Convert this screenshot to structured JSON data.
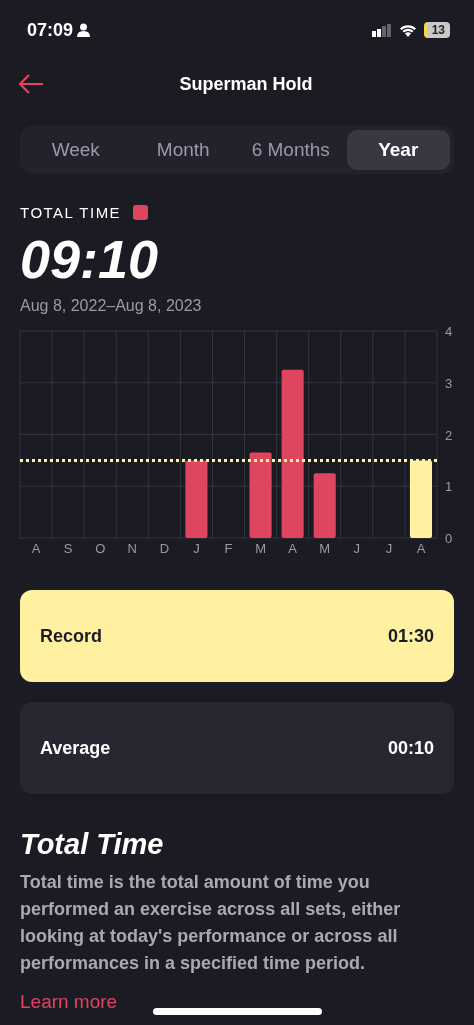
{
  "status_bar": {
    "time": "07:09",
    "battery": "13"
  },
  "header": {
    "title": "Superman Hold"
  },
  "tabs": [
    {
      "label": "Week",
      "selected": false
    },
    {
      "label": "Month",
      "selected": false
    },
    {
      "label": "6 Months",
      "selected": false
    },
    {
      "label": "Year",
      "selected": true
    }
  ],
  "summary": {
    "label": "TOTAL TIME",
    "color": "#e0455f",
    "value": "09:10",
    "range": "Aug 8, 2022–Aug 8, 2023"
  },
  "chart_data": {
    "type": "bar",
    "categories": [
      "A",
      "S",
      "O",
      "N",
      "D",
      "J",
      "F",
      "M",
      "A",
      "M",
      "J",
      "J",
      "A"
    ],
    "ylim": [
      0,
      4
    ],
    "yticks": [
      0,
      1,
      2,
      3,
      4
    ],
    "stacked": true,
    "grid": true,
    "series": [
      {
        "color": "#e0455f",
        "values": [
          null,
          null,
          null,
          null,
          null,
          1.5,
          null,
          1.65,
          3.25,
          1.25,
          null,
          null,
          null
        ]
      },
      {
        "color": "#fff1a0",
        "values": [
          null,
          null,
          null,
          null,
          null,
          null,
          null,
          null,
          null,
          null,
          null,
          null,
          1.5
        ]
      }
    ],
    "ref_lines": [
      {
        "axis": "y",
        "value": 1.5,
        "color": "#fff1a0"
      }
    ]
  },
  "stats": [
    {
      "label": "Record",
      "value": "01:30",
      "selected": true
    },
    {
      "label": "Average",
      "value": "00:10",
      "selected": false
    }
  ],
  "info": {
    "title": "Total Time",
    "text": "Total time is the total amount of time you performed an exercise across all sets, either looking at today's performance or across all performances in a specified time period.",
    "link": "Learn more"
  }
}
